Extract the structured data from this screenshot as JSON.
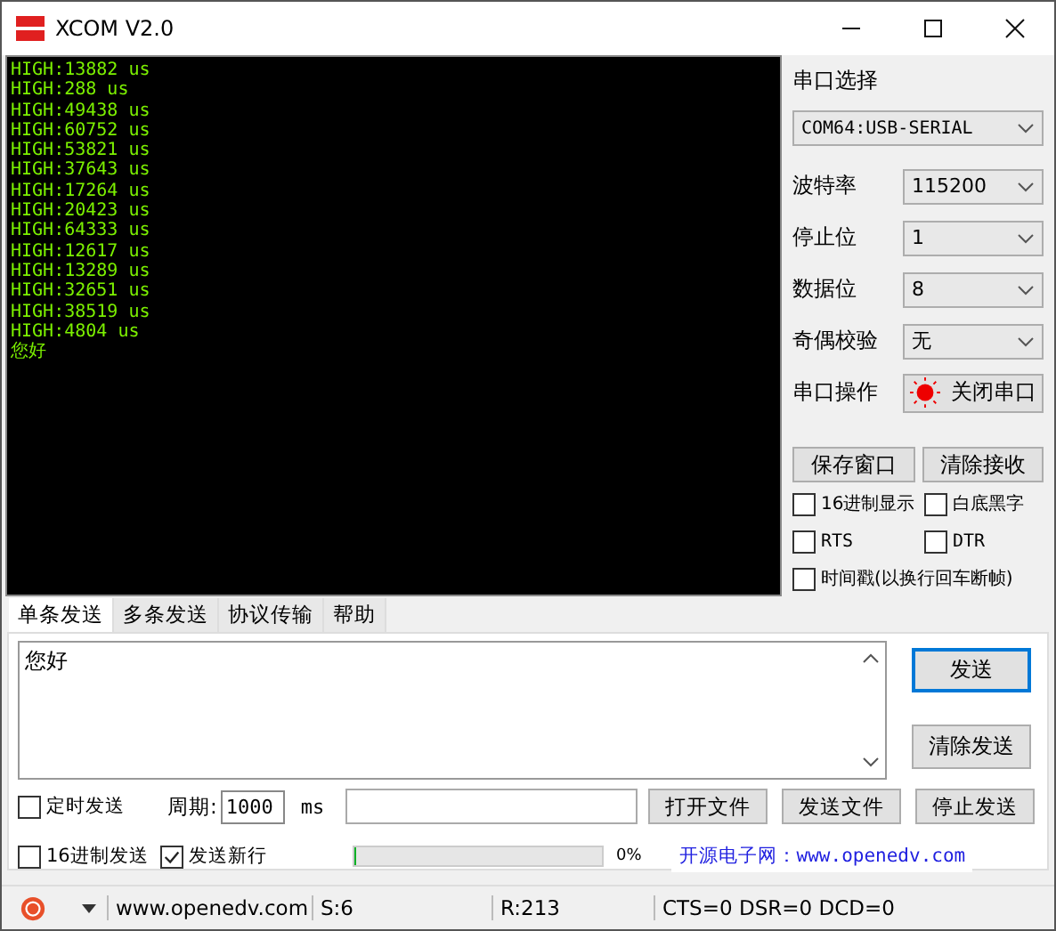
{
  "window": {
    "title": "XCOM V2.0"
  },
  "receive": {
    "lines": [
      "HIGH:13882 us",
      "HIGH:288 us",
      "HIGH:49438 us",
      "HIGH:60752 us",
      "HIGH:53821 us",
      "HIGH:37643 us",
      "HIGH:17264 us",
      "HIGH:20423 us",
      "HIGH:64333 us",
      "HIGH:12617 us",
      "HIGH:13289 us",
      "HIGH:32651 us",
      "HIGH:38519 us",
      "HIGH:4804 us",
      "您好"
    ]
  },
  "serial": {
    "port_label": "串口选择",
    "port": "COM64:USB-SERIAL",
    "settings": [
      {
        "label": "波特率",
        "value": "115200"
      },
      {
        "label": "停止位",
        "value": "1"
      },
      {
        "label": "数据位",
        "value": "8"
      },
      {
        "label": "奇偶校验",
        "value": "无"
      }
    ],
    "operation_label": "串口操作",
    "operation_button": {
      "label": "关闭串口",
      "open": true
    }
  },
  "receive_buttons": [
    "保存窗口",
    "清除接收"
  ],
  "option_rows": [
    [
      {
        "label": "16进制显示",
        "checked": false,
        "kind": "cjk"
      },
      {
        "label": "白底黑字",
        "checked": false,
        "kind": "cjk"
      }
    ],
    [
      {
        "label": "RTS",
        "checked": false,
        "kind": "mono"
      },
      {
        "label": "DTR",
        "checked": false,
        "kind": "mono"
      }
    ],
    [
      {
        "label": "时间戳(以换行回车断帧)",
        "checked": false,
        "kind": "cjk"
      }
    ]
  ],
  "tabs": [
    {
      "label": "单条发送",
      "selected": true
    },
    {
      "label": "多条发送",
      "selected": false
    },
    {
      "label": "协议传输",
      "selected": false
    },
    {
      "label": "帮助",
      "selected": false
    }
  ],
  "send": {
    "text": "您好",
    "buttons": [
      "发送",
      "清除发送"
    ]
  },
  "timed": {
    "label": "定时发送",
    "checked": false
  },
  "period": {
    "label": "周期:",
    "value": "1000",
    "unit": "ms"
  },
  "file_buttons": [
    "打开文件",
    "发送文件",
    "停止发送"
  ],
  "hex_send": {
    "label": "16进制发送",
    "checked": false
  },
  "newline": {
    "label": "发送新行",
    "checked": true
  },
  "progress": {
    "level": 0,
    "reading": "0%"
  },
  "link": "开源电子网：www.openedv.com",
  "status_bar": {
    "url": "www.openedv.com",
    "sent": "S:6",
    "received": "R:213",
    "lines": "CTS=0 DSR=0 DCD=0"
  }
}
